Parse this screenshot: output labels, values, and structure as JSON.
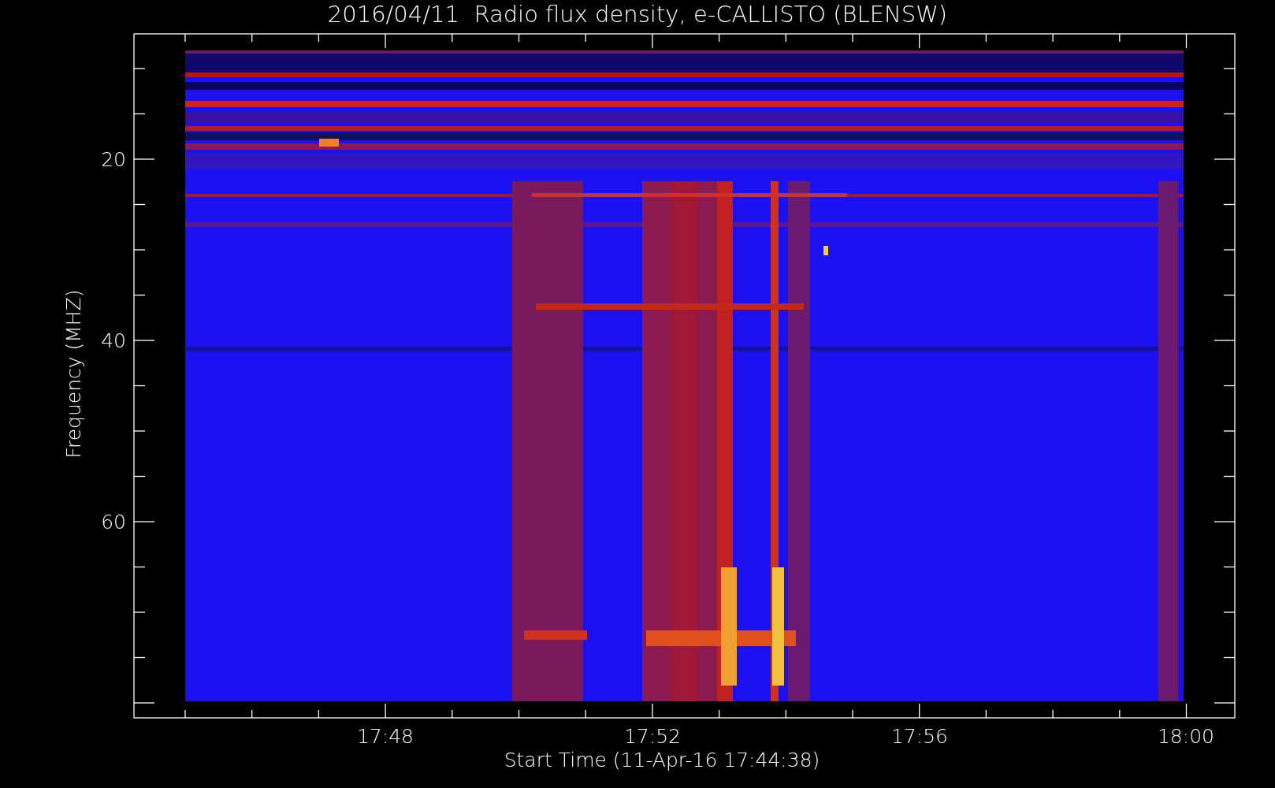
{
  "title": "2016/04/11  Radio flux density, e-CALLISTO (BLENSW)",
  "y_axis": {
    "label": "Frequency (MHZ)",
    "ticks": [
      "20",
      "40",
      "60"
    ]
  },
  "x_axis": {
    "label": "Start Time (11-Apr-16 17:44:38)",
    "ticks": [
      "17:48",
      "17:52",
      "17:56",
      "18:00"
    ]
  }
}
